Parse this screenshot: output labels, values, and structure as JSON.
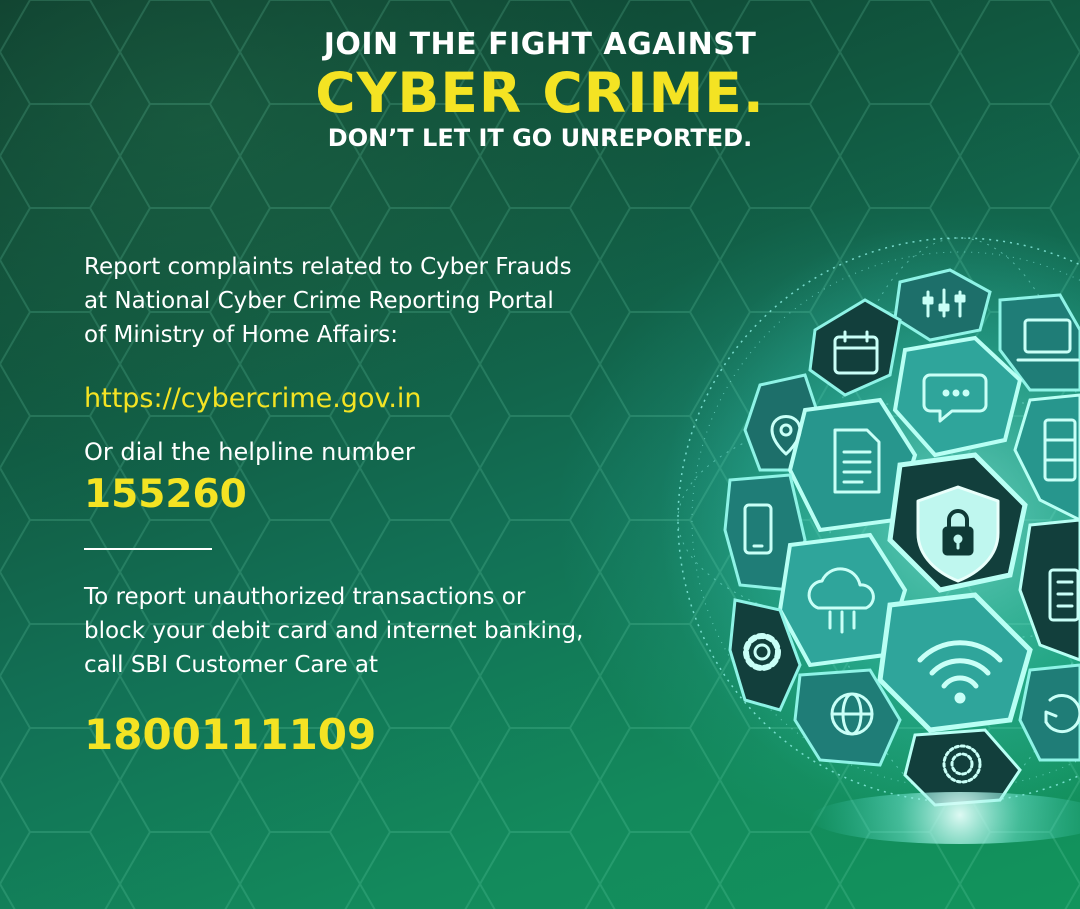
{
  "header": {
    "line1": "JOIN THE FIGHT AGAINST",
    "line2": "CYBER CRIME.",
    "line3": "DON’T LET IT GO UNREPORTED."
  },
  "portal_intro": [
    "Report complaints related to Cyber Frauds",
    "at National Cyber Crime Reporting Portal",
    "of Ministry of Home Affairs:"
  ],
  "portal_url": "https://cybercrime.gov.in",
  "helpline_label": "Or dial the helpline number",
  "helpline_number": "155260",
  "sbi_intro": [
    "To report unauthorized transactions or",
    "block your debit card and internet banking,",
    "call SBI Customer Care at"
  ],
  "sbi_number": "1800111109",
  "colors": {
    "accent_yellow": "#f4e323",
    "bg_dark_green": "#0d3b2c",
    "bg_green": "#12945c",
    "globe_teal": "#3fd6c9"
  },
  "globe_icons": [
    "equalizer-icon",
    "calendar-icon",
    "laptop-icon",
    "chat-icon",
    "document-icon",
    "padlock-shield-icon",
    "cloud-icon",
    "wifi-icon",
    "globe-icon",
    "gear-icon",
    "mobile-icon",
    "notebook-icon",
    "location-pin-icon",
    "fingerprint-icon",
    "server-icon",
    "refresh-icon"
  ]
}
